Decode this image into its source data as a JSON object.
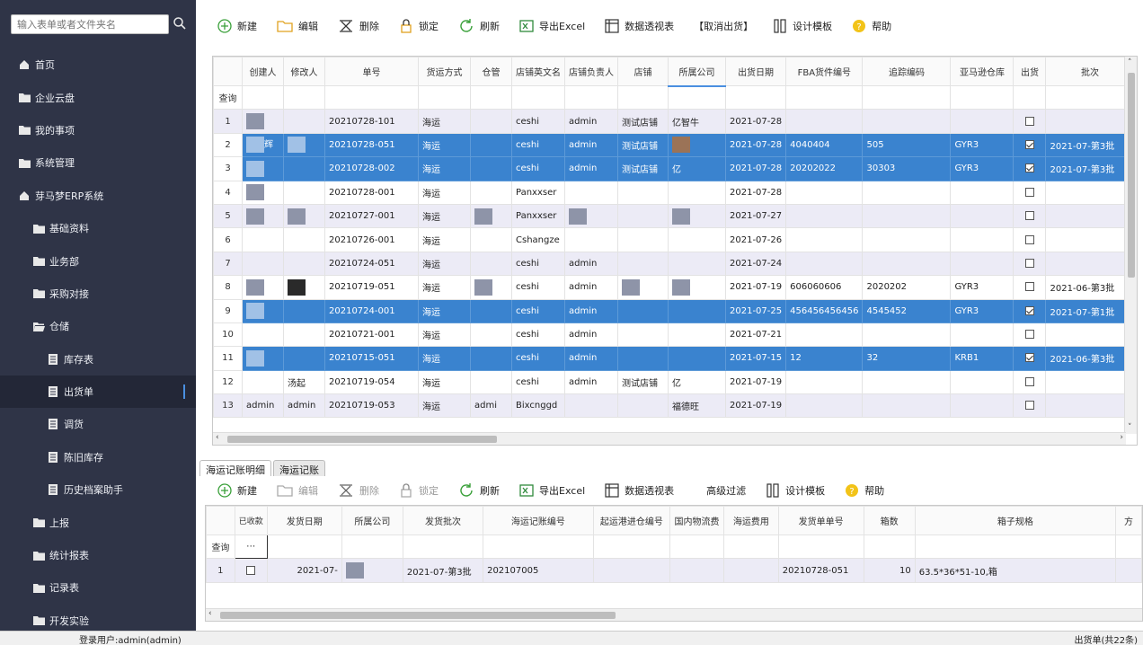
{
  "search": {
    "placeholder": "输入表单或者文件夹名"
  },
  "sidebar": {
    "items": [
      {
        "label": "首页",
        "icon": "home-icon"
      },
      {
        "label": "企业云盘",
        "icon": "folder-icon"
      },
      {
        "label": "我的事项",
        "icon": "folder-icon"
      },
      {
        "label": "系统管理",
        "icon": "folder-icon"
      },
      {
        "label": "芽马梦ERP系统",
        "icon": "home-icon"
      },
      {
        "label": "基础资料",
        "icon": "folder-icon"
      },
      {
        "label": "业务部",
        "icon": "folder-icon"
      },
      {
        "label": "采购对接",
        "icon": "folder-icon"
      },
      {
        "label": "仓储",
        "icon": "folder-open-icon"
      },
      {
        "label": "库存表",
        "icon": "document-icon"
      },
      {
        "label": "出货单",
        "icon": "document-icon"
      },
      {
        "label": "调货",
        "icon": "document-icon"
      },
      {
        "label": "陈旧库存",
        "icon": "document-icon"
      },
      {
        "label": "历史档案助手",
        "icon": "document-icon"
      },
      {
        "label": "上报",
        "icon": "folder-icon"
      },
      {
        "label": "统计报表",
        "icon": "folder-icon"
      },
      {
        "label": "记录表",
        "icon": "folder-icon"
      },
      {
        "label": "开发实验",
        "icon": "folder-icon"
      }
    ]
  },
  "toolbar": {
    "new": "新建",
    "edit": "编辑",
    "delete": "删除",
    "lock": "锁定",
    "refresh": "刷新",
    "export": "导出Excel",
    "pivot": "数据透视表",
    "cancel_ship": "【取消出货】",
    "design": "设计模板",
    "help": "帮助"
  },
  "grid": {
    "columns": [
      "创建人",
      "修改人",
      "单号",
      "货运方式",
      "仓管",
      "店铺英文名",
      "店铺负责人",
      "店铺",
      "所属公司",
      "出货日期",
      "FBA货件编号",
      "追踪编码",
      "亚马逊仓库",
      "出货",
      "批次"
    ],
    "query_label": "查询",
    "rows": [
      {
        "n": "1",
        "creator": "",
        "modifier": "",
        "order": "20210728-101",
        "ship": "海运",
        "wm": "",
        "shop_en": "ceshi",
        "owner": "admin",
        "shop": "测试店铺",
        "company": "亿智牛",
        "date": "2021-07-28",
        "fba": "",
        "track": "",
        "wh": "",
        "out": false,
        "batch": ""
      },
      {
        "n": "2",
        "creator": "辉",
        "modifier": "",
        "order": "20210728-051",
        "ship": "海运",
        "wm": "",
        "shop_en": "ceshi",
        "owner": "admin",
        "shop": "测试店铺",
        "company": "",
        "date": "2021-07-28",
        "fba": "4040404",
        "track": "505",
        "wh": "GYR3",
        "out": true,
        "batch": "2021-07-第3批"
      },
      {
        "n": "3",
        "creator": "",
        "modifier": "",
        "order": "20210728-002",
        "ship": "海运",
        "wm": "",
        "shop_en": "ceshi",
        "owner": "admin",
        "shop": "测试店铺",
        "company": "亿",
        "date": "2021-07-28",
        "fba": "20202022",
        "track": "30303",
        "wh": "GYR3",
        "out": true,
        "batch": "2021-07-第3批"
      },
      {
        "n": "4",
        "creator": "",
        "modifier": "",
        "order": "20210728-001",
        "ship": "海运",
        "wm": "",
        "shop_en": "Panxxser",
        "owner": "",
        "shop": "",
        "company": "",
        "date": "2021-07-28",
        "fba": "",
        "track": "",
        "wh": "",
        "out": false,
        "batch": ""
      },
      {
        "n": "5",
        "creator": "",
        "modifier": "",
        "order": "20210727-001",
        "ship": "海运",
        "wm": "",
        "shop_en": "Panxxser",
        "owner": "",
        "shop": "",
        "company": "",
        "date": "2021-07-27",
        "fba": "",
        "track": "",
        "wh": "",
        "out": false,
        "batch": ""
      },
      {
        "n": "6",
        "creator": "",
        "modifier": "",
        "order": "20210726-001",
        "ship": "海运",
        "wm": "",
        "shop_en": "Cshangze",
        "owner": "",
        "shop": "",
        "company": "",
        "date": "2021-07-26",
        "fba": "",
        "track": "",
        "wh": "",
        "out": false,
        "batch": ""
      },
      {
        "n": "7",
        "creator": "",
        "modifier": "",
        "order": "20210724-051",
        "ship": "海运",
        "wm": "",
        "shop_en": "ceshi",
        "owner": "admin",
        "shop": "",
        "company": "",
        "date": "2021-07-24",
        "fba": "",
        "track": "",
        "wh": "",
        "out": false,
        "batch": ""
      },
      {
        "n": "8",
        "creator": "",
        "modifier": "",
        "order": "20210719-051",
        "ship": "海运",
        "wm": "",
        "shop_en": "ceshi",
        "owner": "admin",
        "shop": "",
        "company": "",
        "date": "2021-07-19",
        "fba": "606060606",
        "track": "2020202",
        "wh": "GYR3",
        "out": false,
        "batch": "2021-06-第3批"
      },
      {
        "n": "9",
        "creator": "",
        "modifier": "",
        "order": "20210724-001",
        "ship": "海运",
        "wm": "",
        "shop_en": "ceshi",
        "owner": "admin",
        "shop": "",
        "company": "",
        "date": "2021-07-25",
        "fba": "456456456456",
        "track": "4545452",
        "wh": "GYR3",
        "out": true,
        "batch": "2021-07-第1批"
      },
      {
        "n": "10",
        "creator": "",
        "modifier": "",
        "order": "20210721-001",
        "ship": "海运",
        "wm": "",
        "shop_en": "ceshi",
        "owner": "admin",
        "shop": "",
        "company": "",
        "date": "2021-07-21",
        "fba": "",
        "track": "",
        "wh": "",
        "out": false,
        "batch": ""
      },
      {
        "n": "11",
        "creator": "",
        "modifier": "",
        "order": "20210715-051",
        "ship": "海运",
        "wm": "",
        "shop_en": "ceshi",
        "owner": "admin",
        "shop": "",
        "company": "",
        "date": "2021-07-15",
        "fba": "12",
        "track": "32",
        "wh": "KRB1",
        "out": true,
        "batch": "2021-06-第3批"
      },
      {
        "n": "12",
        "creator": "",
        "modifier": "汤起",
        "order": "20210719-054",
        "ship": "海运",
        "wm": "",
        "shop_en": "ceshi",
        "owner": "admin",
        "shop": "测试店铺",
        "company": "亿",
        "date": "2021-07-19",
        "fba": "",
        "track": "",
        "wh": "",
        "out": false,
        "batch": ""
      },
      {
        "n": "13",
        "creator": "admin",
        "modifier": "admin",
        "order": "20210719-053",
        "ship": "海运",
        "wm": "admi",
        "shop_en": "Bixcnggd",
        "owner": "",
        "shop": "",
        "company": "福德旺",
        "date": "2021-07-19",
        "fba": "",
        "track": "",
        "wh": "",
        "out": false,
        "batch": ""
      }
    ]
  },
  "tabs": [
    "海运记账明细",
    "海运记账"
  ],
  "toolbar2": {
    "new": "新建",
    "edit": "编辑",
    "delete": "删除",
    "lock": "锁定",
    "refresh": "刷新",
    "export": "导出Excel",
    "pivot": "数据透视表",
    "filter": "高级过滤",
    "design": "设计模板",
    "help": "帮助"
  },
  "grid2": {
    "columns": [
      "已收款",
      "发货日期",
      "所属公司",
      "发货批次",
      "海运记账编号",
      "起运港进仓编号",
      "国内物流费",
      "海运费用",
      "发货单单号",
      "箱数",
      "箱子规格",
      "方"
    ],
    "query_label": "查询",
    "rows": [
      {
        "n": "1",
        "received": false,
        "date": "2021-07-",
        "company": "",
        "batch": "2021-07-第3批",
        "code": "202107005",
        "port": "",
        "domestic": "",
        "freight": "",
        "ship_no": "20210728-051",
        "boxes": "10",
        "spec": "63.5*36*51-10,箱"
      }
    ]
  },
  "status": {
    "user": "登录用户:admin(admin)",
    "count": "出货单(共22条)"
  }
}
